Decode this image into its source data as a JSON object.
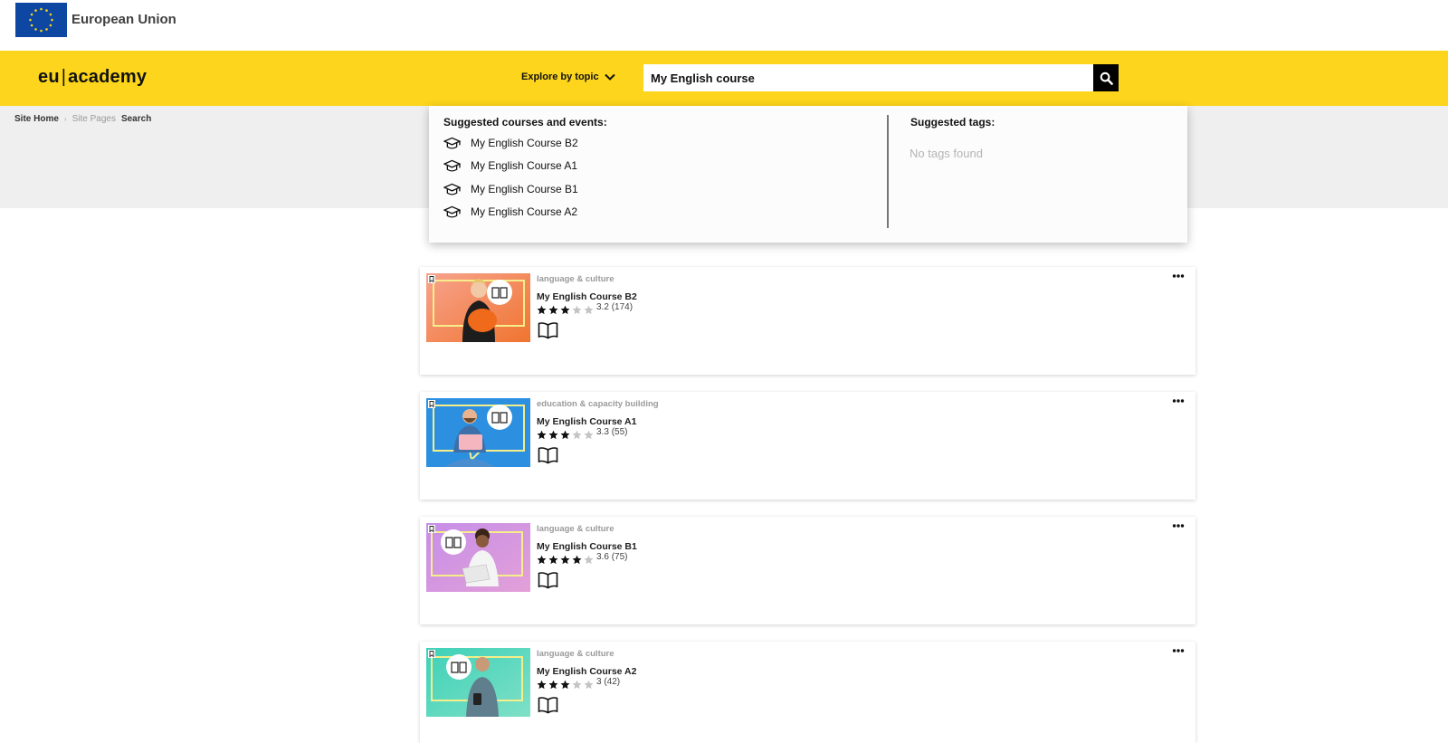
{
  "eu": {
    "name": "European Union"
  },
  "header": {
    "logo_left": "eu",
    "logo_right": "academy",
    "explore_label": "Explore by topic",
    "search_value": "My English course",
    "colors": {
      "brand_yellow": "#fcd51c",
      "eu_blue": "#0e47a1"
    }
  },
  "breadcrumb": {
    "home": "Site Home",
    "pages": "Site Pages",
    "current": "Search"
  },
  "dropdown": {
    "courses_title": "Suggested courses and events:",
    "courses": [
      {
        "label": "My English Course B2"
      },
      {
        "label": "My English Course A1"
      },
      {
        "label": "My English Course B1"
      },
      {
        "label": "My English Course A2"
      }
    ],
    "tags_title": "Suggested tags:",
    "tags_empty": "No tags found"
  },
  "results": [
    {
      "category": "language & culture",
      "title": "My English Course B2",
      "rating": "3.2",
      "count": "(174)",
      "stars": 3
    },
    {
      "category": "education & capacity building",
      "title": "My English Course A1",
      "rating": "3.3",
      "count": "(55)",
      "stars": 3
    },
    {
      "category": "language & culture",
      "title": "My English Course B1",
      "rating": "3.6",
      "count": "(75)",
      "stars": 4
    },
    {
      "category": "language & culture",
      "title": "My English Course A2",
      "rating": "3",
      "count": "(42)",
      "stars": 3
    }
  ]
}
